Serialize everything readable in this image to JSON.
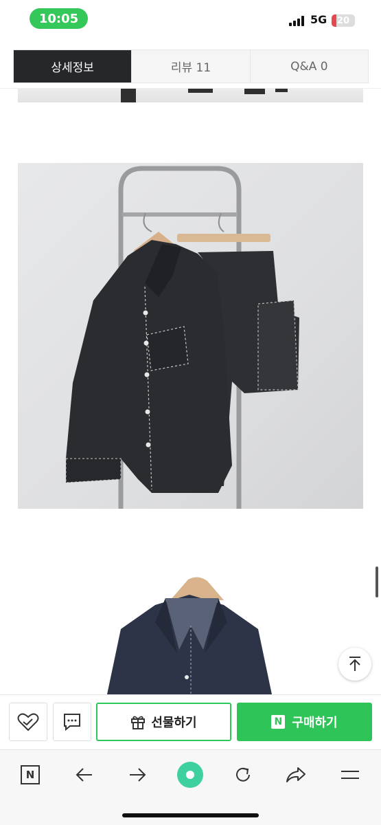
{
  "status_bar": {
    "time": "10:05",
    "network": "5G",
    "battery": "20",
    "battery_level": 0.2,
    "time_pill_color": "#34c759"
  },
  "tabs": [
    {
      "label": "상세정보",
      "active": true
    },
    {
      "label": "리뷰 11",
      "active": false
    },
    {
      "label": "Q&A  0",
      "active": false
    }
  ],
  "purchase_bar": {
    "wishlist_icon": "heart-check-icon",
    "talk_icon": "chat-bubble-icon",
    "gift_label": "선물하기",
    "gift_icon": "gift-icon",
    "buy_label": "구매하기",
    "buy_badge": "N",
    "accent_color": "#2fc458"
  },
  "browser_toolbar": {
    "items": [
      "naver-home-icon",
      "back-arrow-icon",
      "forward-arrow-icon",
      "green-dot-icon",
      "refresh-icon",
      "share-icon",
      "menu-icon"
    ],
    "naver_badge": "N"
  },
  "floating": {
    "scroll_top_icon": "arrow-up-icon"
  }
}
